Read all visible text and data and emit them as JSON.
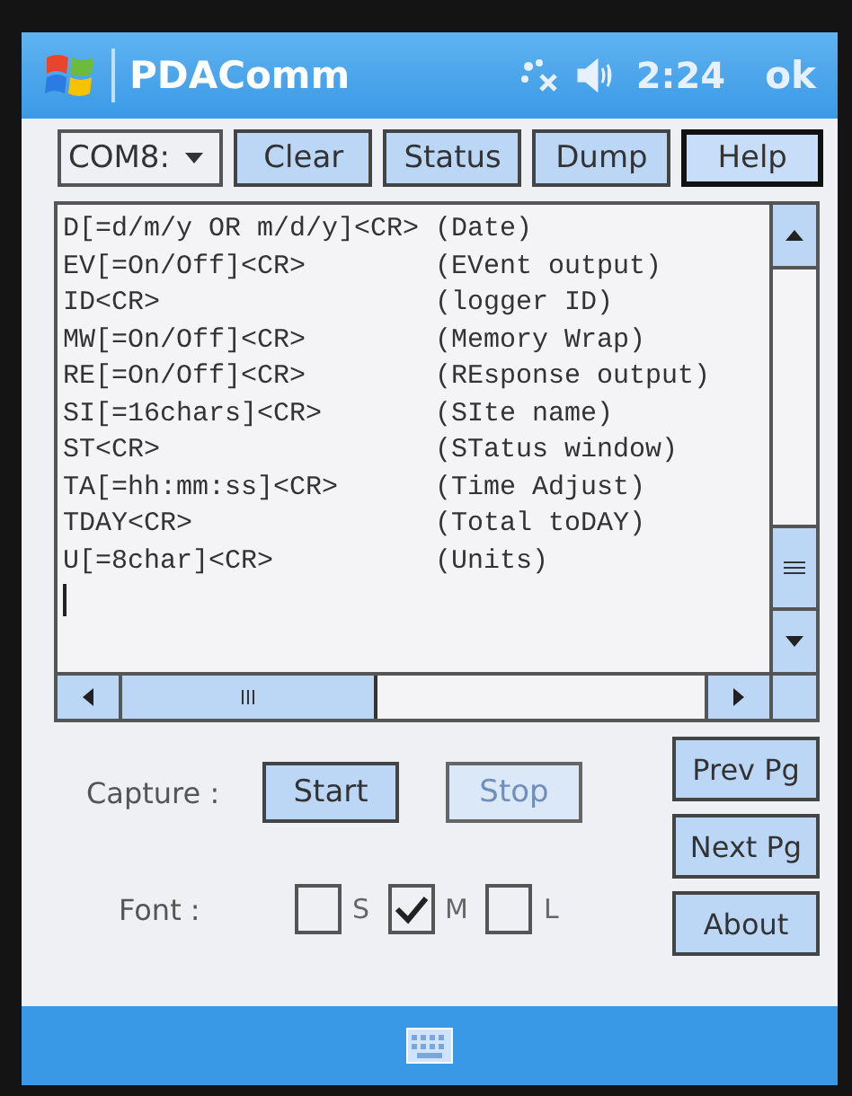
{
  "title_bar": {
    "app_name": "PDAComm",
    "time": "2:24",
    "ok_button": "ok"
  },
  "toolbar": {
    "port_dropdown": "COM8:",
    "buttons": [
      {
        "label": "Clear",
        "selected": false
      },
      {
        "label": "Status",
        "selected": false
      },
      {
        "label": "Dump",
        "selected": false
      },
      {
        "label": "Help",
        "selected": true
      }
    ]
  },
  "output": {
    "lines": [
      {
        "command": "D[=d/m/y OR m/d/y]<CR>",
        "description": "(Date)"
      },
      {
        "command": "EV[=On/Off]<CR>",
        "description": "(EVent output)"
      },
      {
        "command": "ID<CR>",
        "description": "(logger ID)"
      },
      {
        "command": "MW[=On/Off]<CR>",
        "description": "(Memory Wrap)"
      },
      {
        "command": "RE[=On/Off]<CR>",
        "description": "(REsponse output)"
      },
      {
        "command": "SI[=16chars]<CR>",
        "description": "(SIte name)"
      },
      {
        "command": "ST<CR>",
        "description": "(STatus window)"
      },
      {
        "command": "TA[=hh:mm:ss]<CR>",
        "description": "(Time Adjust)"
      },
      {
        "command": "TDAY<CR>",
        "description": "(Total toDAY)"
      },
      {
        "command": "U[=8char]<CR>",
        "description": "(Units)"
      }
    ]
  },
  "capture": {
    "label": "Capture :",
    "buttons": [
      {
        "label": "Start",
        "disabled": false
      },
      {
        "label": "Stop",
        "disabled": true
      }
    ]
  },
  "font": {
    "label": "Font :",
    "options": [
      {
        "label": "S",
        "checked": false
      },
      {
        "label": "M",
        "checked": true
      },
      {
        "label": "L",
        "checked": false
      }
    ]
  },
  "page_buttons": [
    "Prev Pg",
    "Next Pg",
    "About"
  ]
}
